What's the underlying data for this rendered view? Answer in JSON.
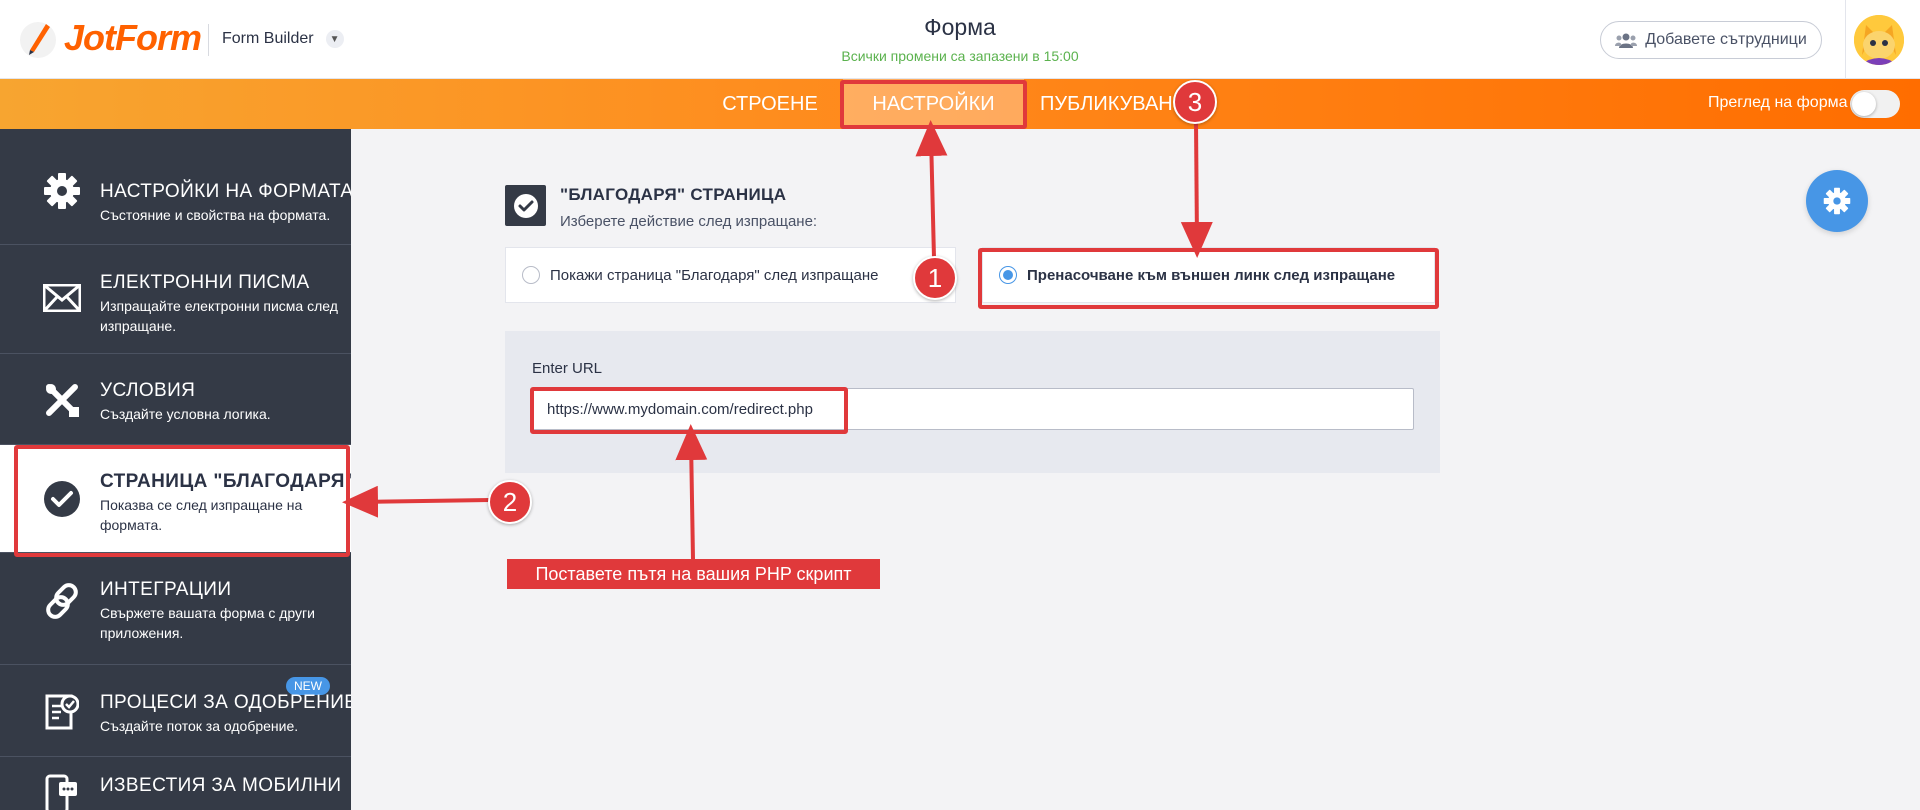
{
  "header": {
    "logo_text": "JotForm",
    "app_name": "Form Builder",
    "form_title": "Форма",
    "save_status": "Всички промени са запазени в 15:00",
    "collab_button": "Добавете сътрудници"
  },
  "nav": {
    "tabs": [
      {
        "label": "СТРОЕНЕ"
      },
      {
        "label": "НАСТРОЙКИ"
      },
      {
        "label": "ПУБЛИКУВАН"
      }
    ],
    "active_tab": "НАСТРОЙКИ",
    "preview_label": "Преглед на форма",
    "preview_on": false
  },
  "sidebar": {
    "items": [
      {
        "title": "НАСТРОЙКИ НА ФОРМАТА",
        "desc": "Състояние и свойства на формата.",
        "icon": "gear-icon"
      },
      {
        "title": "ЕЛЕКТРОННИ ПИСМА",
        "desc": "Изпращайте електронни писма след изпращане.",
        "icon": "envelope-icon"
      },
      {
        "title": "УСЛОВИЯ",
        "desc": "Създайте условна логика.",
        "icon": "conditions-icon"
      },
      {
        "title": "СТРАНИЦА \"БЛАГОДАРЯ\"",
        "desc": "Показва се след изпращане на формата.",
        "icon": "check-circle-icon"
      },
      {
        "title": "ИНТЕГРАЦИИ",
        "desc": "Свържете вашата форма с други приложения.",
        "icon": "link-icon"
      },
      {
        "title": "ПРОЦЕСИ ЗА ОДОБРЕНИЕ",
        "desc": "Създайте поток за одобрение.",
        "icon": "approval-icon",
        "badge": "NEW"
      },
      {
        "title": "ИЗВЕСТИЯ ЗА МОБИЛНИ",
        "desc": "",
        "icon": "mobile-icon"
      }
    ],
    "active_index": 3
  },
  "main": {
    "section_title": "\"БЛАГОДАРЯ\" СТРАНИЦА",
    "section_sub": "Изберете действие след изпращане:",
    "option_thankyou": "Покажи страница \"Благодаря\" след изпращане",
    "option_redirect": "Пренасочване към външен линк след изпращане",
    "selected_option": "redirect",
    "url_label": "Enter URL",
    "url_value": "https://www.mydomain.com/redirect.php"
  },
  "annotations": {
    "badge1": "1",
    "badge2": "2",
    "badge3": "3",
    "callout": "Поставете пътя на вашия PHP скрипт"
  },
  "colors": {
    "brand_orange": "#ff6100",
    "accent_blue": "#4796e6",
    "sidebar_bg": "#343a46",
    "annotation_red": "#e0393b",
    "saved_green": "#5bb24e"
  }
}
